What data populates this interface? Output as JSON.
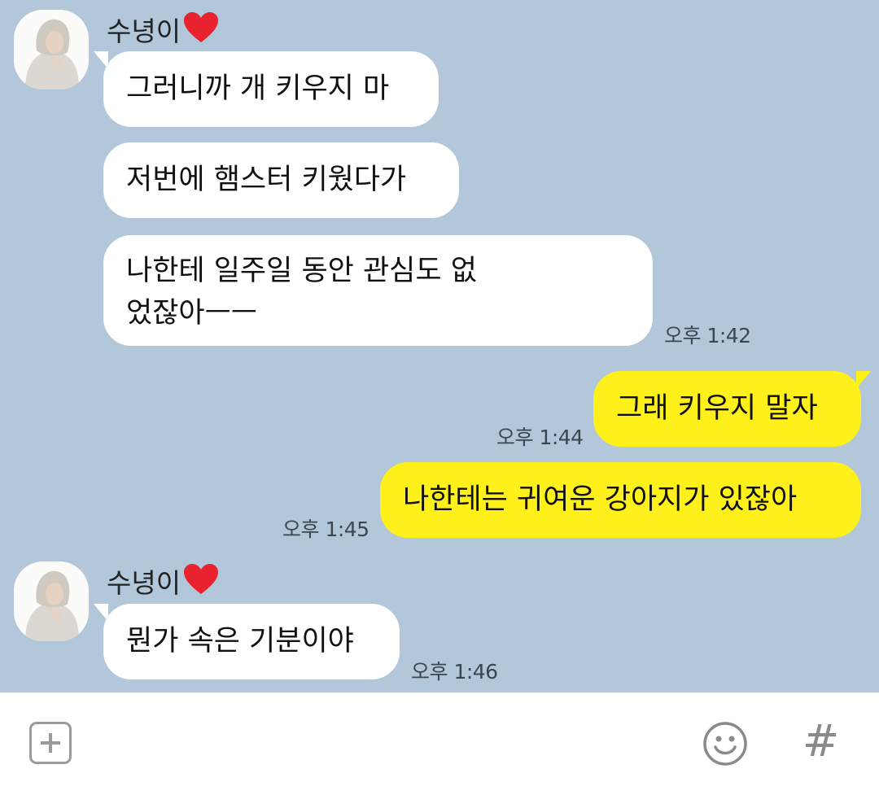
{
  "chat": {
    "sender_name": "수녕이",
    "messages": [
      {
        "text": "그러니까 개 키우지 마"
      },
      {
        "text": "저번에 햄스터 키웠다가"
      },
      {
        "text": "나한테 일주일 동안 관심도 없었잖아ㅡㅡ",
        "time": "오후 1:42"
      },
      {
        "text": "그래 키우지 말자",
        "time": "오후 1:44"
      },
      {
        "text": "나한테는 귀여운 강아지가 있잖아",
        "time": "오후 1:45"
      },
      {
        "text": "뭔가 속은 기분이야",
        "time": "오후 1:46"
      }
    ]
  },
  "icons": {
    "heart": "heart-icon",
    "attach": "plus-icon",
    "emoji": "emoji-icon",
    "hashtag": "hash-icon"
  },
  "input_bar": {
    "hashtag_symbol": "#"
  },
  "colors": {
    "chat_background": "#b2c7da",
    "incoming_bubble": "#ffffff",
    "outgoing_bubble": "#fef01b",
    "heart": "#e8222f"
  }
}
